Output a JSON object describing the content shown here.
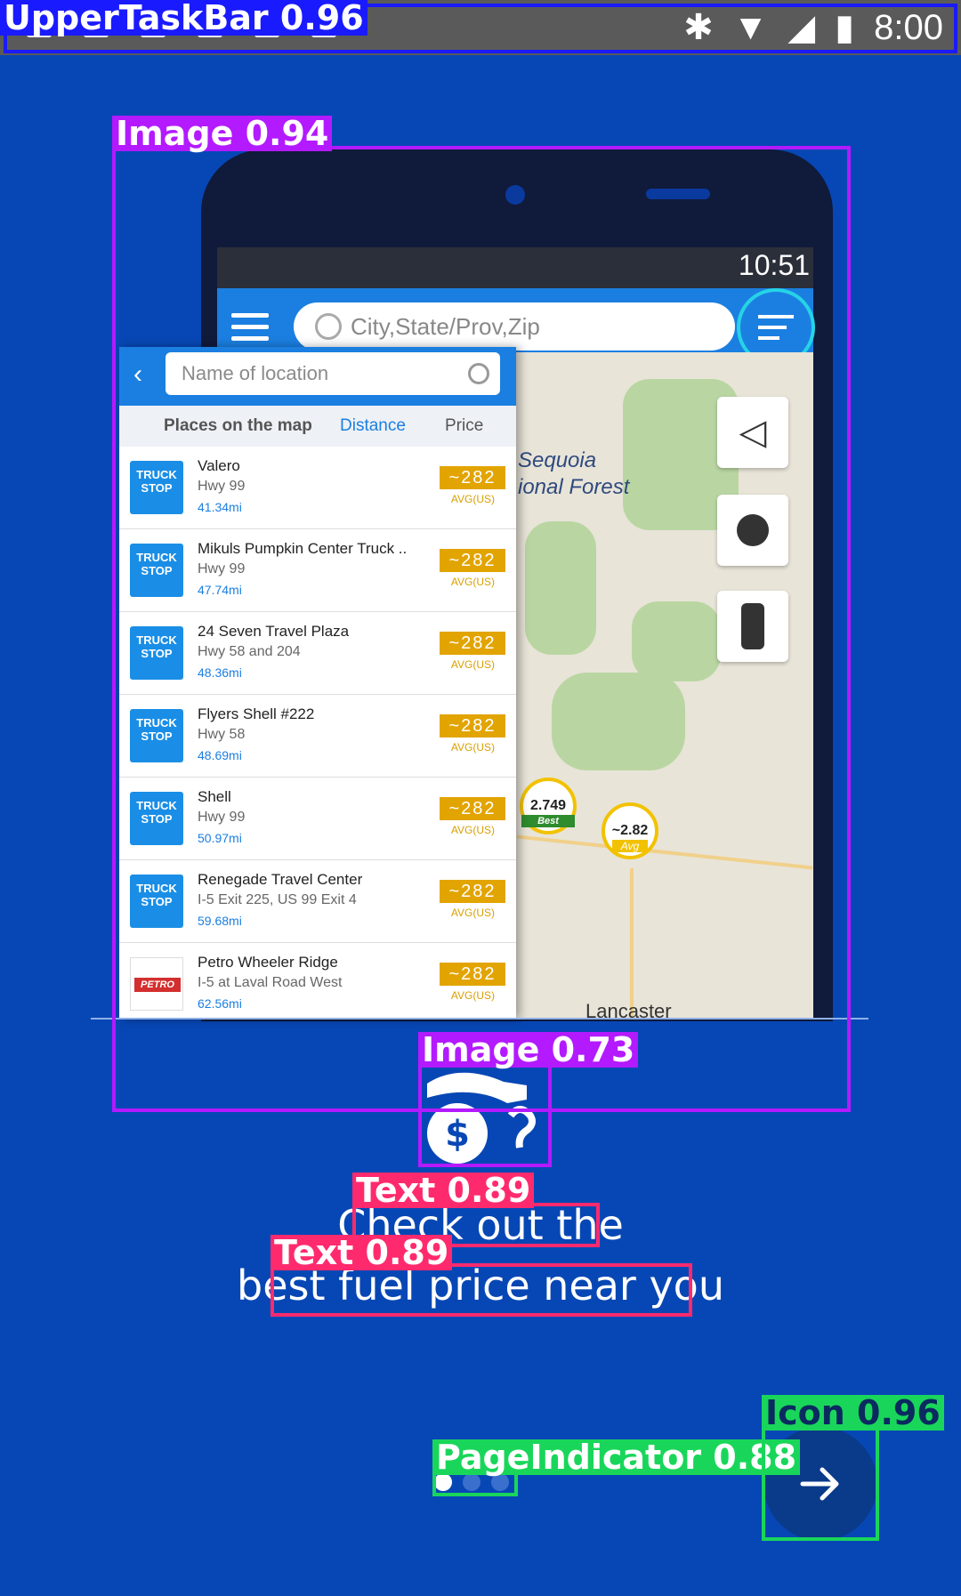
{
  "statusbar": {
    "time": "8:00"
  },
  "detections": {
    "taskbar": "UpperTaskBar 0.96",
    "image_main": "Image 0.94",
    "image_icon": "Image 0.73",
    "text_1": "Text 0.89",
    "text_2": "Text 0.89",
    "icon": "Icon 0.96",
    "page_indicator": "PageIndicator 0.88"
  },
  "mockup": {
    "inner_time": "10:51",
    "search_placeholder": "City,State/Prov,Zip",
    "panel_search_placeholder": "Name of location",
    "sort_label": "Places on the map",
    "sort_distance": "Distance",
    "sort_price": "Price",
    "map_labels": [
      "Sequoia",
      "ional Forest",
      "Lancaster"
    ],
    "pins": [
      {
        "price": "2.749",
        "tag": "Best"
      },
      {
        "price": "~2.82",
        "tag": "Avg"
      }
    ],
    "stations": [
      {
        "name": "Valero",
        "addr": "Hwy 99",
        "dist": "41.34mi",
        "price": "~282",
        "unit": "AVG(US)",
        "logo": "TRUCK STOP"
      },
      {
        "name": "Mikuls Pumpkin Center Truck ..",
        "addr": "Hwy 99",
        "dist": "47.74mi",
        "price": "~282",
        "unit": "AVG(US)",
        "logo": "TRUCK STOP"
      },
      {
        "name": "24 Seven Travel Plaza",
        "addr": "Hwy 58 and 204",
        "dist": "48.36mi",
        "price": "~282",
        "unit": "AVG(US)",
        "logo": "TRUCK STOP"
      },
      {
        "name": "Flyers Shell #222",
        "addr": "Hwy 58",
        "dist": "48.69mi",
        "price": "~282",
        "unit": "AVG(US)",
        "logo": "TRUCK STOP"
      },
      {
        "name": "Shell",
        "addr": "Hwy 99",
        "dist": "50.97mi",
        "price": "~282",
        "unit": "AVG(US)",
        "logo": "TRUCK STOP"
      },
      {
        "name": "Renegade Travel Center",
        "addr": "I-5 Exit 225, US 99 Exit 4",
        "dist": "59.68mi",
        "price": "~282",
        "unit": "AVG(US)",
        "logo": "TRUCK STOP"
      },
      {
        "name": "Petro Wheeler Ridge",
        "addr": "I-5 at Laval Road West",
        "dist": "62.56mi",
        "price": "~282",
        "unit": "AVG(US)",
        "logo": "PETRO"
      }
    ]
  },
  "headline": {
    "line1": "Check out the",
    "line2": "best fuel price near you"
  },
  "pager": {
    "count": 3,
    "active": 0
  },
  "colors": {
    "background": "#0747b5",
    "taskbar_box": "#1a1aff",
    "image_box": "#b31aff",
    "text_box": "#ff2a6d",
    "icon_box": "#19d65a"
  }
}
